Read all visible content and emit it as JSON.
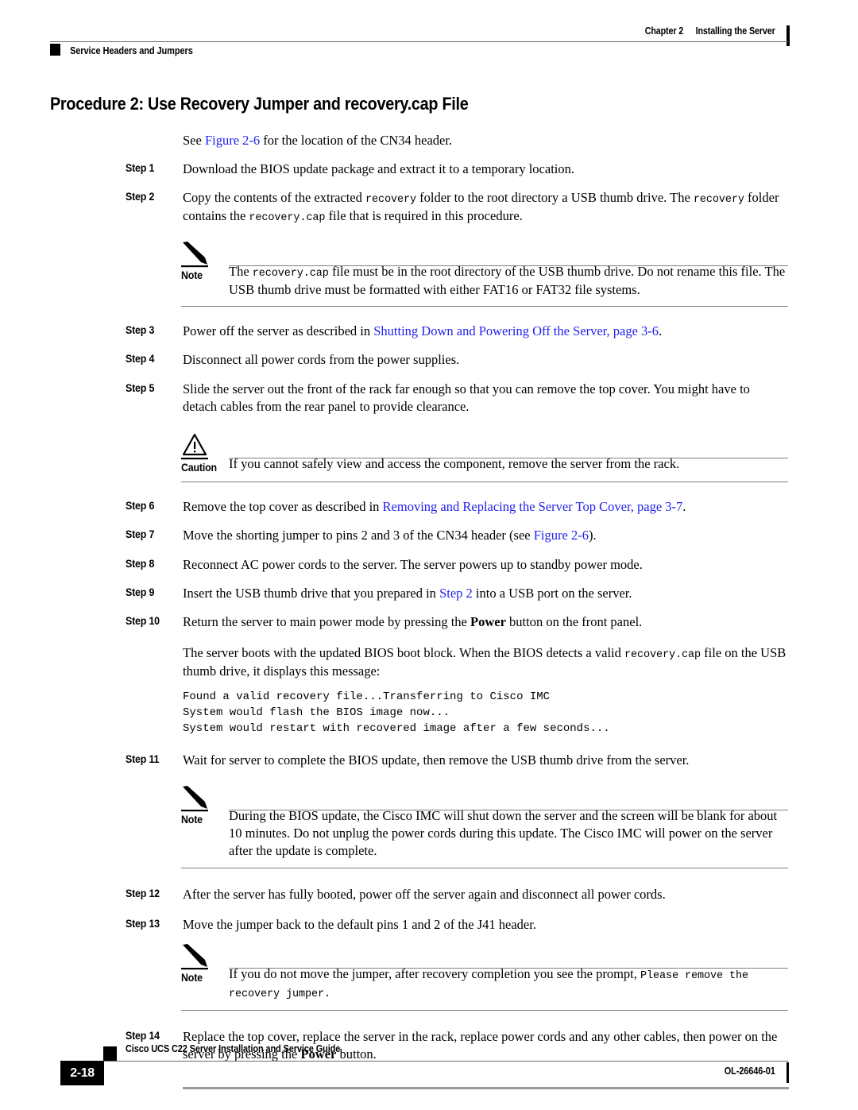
{
  "header": {
    "chapter": "Chapter 2",
    "chapter_title": "Installing the Server",
    "section": "Service Headers and Jumpers"
  },
  "title": "Procedure 2: Use Recovery Jumper and recovery.cap File",
  "lead": {
    "before": "See ",
    "link": "Figure 2-6",
    "after": " for the location of the CN34 header."
  },
  "steps": {
    "s1": {
      "label": "Step 1",
      "text": "Download the BIOS update package and extract it to a temporary location."
    },
    "s2": {
      "label": "Step 2",
      "t1": "Copy the contents of the extracted ",
      "c1": "recovery",
      "t2": " folder to the root directory a USB thumb drive. The ",
      "c2": "recovery",
      "t3": " folder contains the ",
      "c3": "recovery.cap",
      "t4": " file that is required in this procedure."
    },
    "s3": {
      "label": "Step 3",
      "t1": "Power off the server as described in ",
      "link": "Shutting Down and Powering Off the Server, page 3-6",
      "t2": "."
    },
    "s4": {
      "label": "Step 4",
      "text": "Disconnect all power cords from the power supplies."
    },
    "s5": {
      "label": "Step 5",
      "text": "Slide the server out the front of the rack far enough so that you can remove the top cover. You might have to detach cables from the rear panel to provide clearance."
    },
    "s6": {
      "label": "Step 6",
      "t1": "Remove the top cover as described in ",
      "link": "Removing and Replacing the Server Top Cover, page 3-7",
      "t2": "."
    },
    "s7": {
      "label": "Step 7",
      "t1": "Move the shorting jumper to pins 2 and 3 of the CN34 header (see ",
      "link": "Figure 2-6",
      "t2": ")."
    },
    "s8": {
      "label": "Step 8",
      "text": "Reconnect AC power cords to the server. The server powers up to standby power mode."
    },
    "s9": {
      "label": "Step 9",
      "t1": "Insert the USB thumb drive that you prepared in ",
      "link": "Step 2",
      "t2": " into a USB port on the server."
    },
    "s10": {
      "label": "Step 10",
      "t1": "Return the server to main power mode by pressing the ",
      "bold": "Power",
      "t2": " button on the front panel."
    },
    "s11": {
      "label": "Step 11",
      "text": "Wait for server to complete the BIOS update, then remove the USB thumb drive from the server."
    },
    "s12": {
      "label": "Step 12",
      "text": "After the server has fully booted, power off the server again and disconnect all power cords."
    },
    "s13": {
      "label": "Step 13",
      "text": "Move the jumper back to the default pins 1 and 2 of the J41 header."
    },
    "s14": {
      "label": "Step 14",
      "t1": "Replace the top cover, replace the server in the rack, replace power cords and any other cables, then power on the server by pressing the ",
      "bold": "Power",
      "t2": " button."
    }
  },
  "note1": {
    "label": "Note",
    "t1": "The ",
    "c1": "recovery.cap",
    "t2": " file must be in the root directory of the USB thumb drive. Do not rename this file. The USB thumb drive must be formatted with either FAT16 or FAT32 file systems."
  },
  "caution1": {
    "label": "Caution",
    "text": "If you cannot safely view and access the component, remove the server from the rack."
  },
  "boot_para": {
    "t1": "The server boots with the updated BIOS boot block. When the BIOS detects a valid ",
    "c1": "recovery.cap",
    "t2": " file on the USB thumb drive, it displays this message:"
  },
  "screen_output": "Found a valid recovery file...Transferring to Cisco IMC\nSystem would flash the BIOS image now...\nSystem would restart with recovered image after a few seconds...",
  "note2": {
    "label": "Note",
    "text": "During the BIOS update, the Cisco IMC will shut down the server and the screen will be blank for about 10 minutes. Do not unplug the power cords during this update. The Cisco IMC will power on the server after the update is complete."
  },
  "note3": {
    "label": "Note",
    "t1": "If you do not move the jumper, after recovery completion you see the prompt, ",
    "c1": "Please remove the recovery jumper."
  },
  "footer": {
    "book_title": "Cisco UCS C22 Server Installation and Service Guide",
    "page_number": "2-18",
    "doc_id": "OL-26646-01"
  },
  "colors": {
    "link": "#2222ee",
    "rule": "#808080",
    "ink": "#000000"
  }
}
